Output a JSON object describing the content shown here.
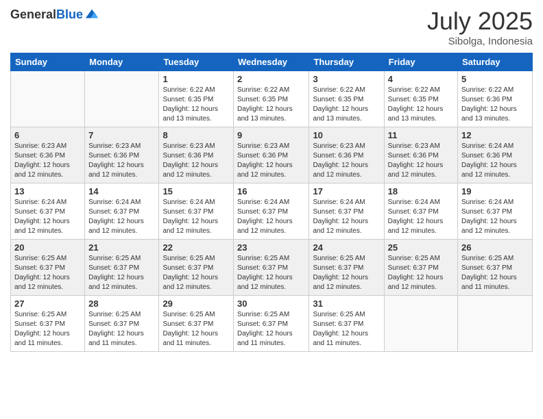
{
  "header": {
    "logo_general": "General",
    "logo_blue": "Blue",
    "month_year": "July 2025",
    "location": "Sibolga, Indonesia"
  },
  "weekdays": [
    "Sunday",
    "Monday",
    "Tuesday",
    "Wednesday",
    "Thursday",
    "Friday",
    "Saturday"
  ],
  "weeks": [
    [
      {
        "day": "",
        "sunrise": "",
        "sunset": "",
        "daylight": ""
      },
      {
        "day": "",
        "sunrise": "",
        "sunset": "",
        "daylight": ""
      },
      {
        "day": "1",
        "sunrise": "Sunrise: 6:22 AM",
        "sunset": "Sunset: 6:35 PM",
        "daylight": "Daylight: 12 hours and 13 minutes."
      },
      {
        "day": "2",
        "sunrise": "Sunrise: 6:22 AM",
        "sunset": "Sunset: 6:35 PM",
        "daylight": "Daylight: 12 hours and 13 minutes."
      },
      {
        "day": "3",
        "sunrise": "Sunrise: 6:22 AM",
        "sunset": "Sunset: 6:35 PM",
        "daylight": "Daylight: 12 hours and 13 minutes."
      },
      {
        "day": "4",
        "sunrise": "Sunrise: 6:22 AM",
        "sunset": "Sunset: 6:35 PM",
        "daylight": "Daylight: 12 hours and 13 minutes."
      },
      {
        "day": "5",
        "sunrise": "Sunrise: 6:22 AM",
        "sunset": "Sunset: 6:36 PM",
        "daylight": "Daylight: 12 hours and 13 minutes."
      }
    ],
    [
      {
        "day": "6",
        "sunrise": "Sunrise: 6:23 AM",
        "sunset": "Sunset: 6:36 PM",
        "daylight": "Daylight: 12 hours and 12 minutes."
      },
      {
        "day": "7",
        "sunrise": "Sunrise: 6:23 AM",
        "sunset": "Sunset: 6:36 PM",
        "daylight": "Daylight: 12 hours and 12 minutes."
      },
      {
        "day": "8",
        "sunrise": "Sunrise: 6:23 AM",
        "sunset": "Sunset: 6:36 PM",
        "daylight": "Daylight: 12 hours and 12 minutes."
      },
      {
        "day": "9",
        "sunrise": "Sunrise: 6:23 AM",
        "sunset": "Sunset: 6:36 PM",
        "daylight": "Daylight: 12 hours and 12 minutes."
      },
      {
        "day": "10",
        "sunrise": "Sunrise: 6:23 AM",
        "sunset": "Sunset: 6:36 PM",
        "daylight": "Daylight: 12 hours and 12 minutes."
      },
      {
        "day": "11",
        "sunrise": "Sunrise: 6:23 AM",
        "sunset": "Sunset: 6:36 PM",
        "daylight": "Daylight: 12 hours and 12 minutes."
      },
      {
        "day": "12",
        "sunrise": "Sunrise: 6:24 AM",
        "sunset": "Sunset: 6:36 PM",
        "daylight": "Daylight: 12 hours and 12 minutes."
      }
    ],
    [
      {
        "day": "13",
        "sunrise": "Sunrise: 6:24 AM",
        "sunset": "Sunset: 6:37 PM",
        "daylight": "Daylight: 12 hours and 12 minutes."
      },
      {
        "day": "14",
        "sunrise": "Sunrise: 6:24 AM",
        "sunset": "Sunset: 6:37 PM",
        "daylight": "Daylight: 12 hours and 12 minutes."
      },
      {
        "day": "15",
        "sunrise": "Sunrise: 6:24 AM",
        "sunset": "Sunset: 6:37 PM",
        "daylight": "Daylight: 12 hours and 12 minutes."
      },
      {
        "day": "16",
        "sunrise": "Sunrise: 6:24 AM",
        "sunset": "Sunset: 6:37 PM",
        "daylight": "Daylight: 12 hours and 12 minutes."
      },
      {
        "day": "17",
        "sunrise": "Sunrise: 6:24 AM",
        "sunset": "Sunset: 6:37 PM",
        "daylight": "Daylight: 12 hours and 12 minutes."
      },
      {
        "day": "18",
        "sunrise": "Sunrise: 6:24 AM",
        "sunset": "Sunset: 6:37 PM",
        "daylight": "Daylight: 12 hours and 12 minutes."
      },
      {
        "day": "19",
        "sunrise": "Sunrise: 6:24 AM",
        "sunset": "Sunset: 6:37 PM",
        "daylight": "Daylight: 12 hours and 12 minutes."
      }
    ],
    [
      {
        "day": "20",
        "sunrise": "Sunrise: 6:25 AM",
        "sunset": "Sunset: 6:37 PM",
        "daylight": "Daylight: 12 hours and 12 minutes."
      },
      {
        "day": "21",
        "sunrise": "Sunrise: 6:25 AM",
        "sunset": "Sunset: 6:37 PM",
        "daylight": "Daylight: 12 hours and 12 minutes."
      },
      {
        "day": "22",
        "sunrise": "Sunrise: 6:25 AM",
        "sunset": "Sunset: 6:37 PM",
        "daylight": "Daylight: 12 hours and 12 minutes."
      },
      {
        "day": "23",
        "sunrise": "Sunrise: 6:25 AM",
        "sunset": "Sunset: 6:37 PM",
        "daylight": "Daylight: 12 hours and 12 minutes."
      },
      {
        "day": "24",
        "sunrise": "Sunrise: 6:25 AM",
        "sunset": "Sunset: 6:37 PM",
        "daylight": "Daylight: 12 hours and 12 minutes."
      },
      {
        "day": "25",
        "sunrise": "Sunrise: 6:25 AM",
        "sunset": "Sunset: 6:37 PM",
        "daylight": "Daylight: 12 hours and 12 minutes."
      },
      {
        "day": "26",
        "sunrise": "Sunrise: 6:25 AM",
        "sunset": "Sunset: 6:37 PM",
        "daylight": "Daylight: 12 hours and 11 minutes."
      }
    ],
    [
      {
        "day": "27",
        "sunrise": "Sunrise: 6:25 AM",
        "sunset": "Sunset: 6:37 PM",
        "daylight": "Daylight: 12 hours and 11 minutes."
      },
      {
        "day": "28",
        "sunrise": "Sunrise: 6:25 AM",
        "sunset": "Sunset: 6:37 PM",
        "daylight": "Daylight: 12 hours and 11 minutes."
      },
      {
        "day": "29",
        "sunrise": "Sunrise: 6:25 AM",
        "sunset": "Sunset: 6:37 PM",
        "daylight": "Daylight: 12 hours and 11 minutes."
      },
      {
        "day": "30",
        "sunrise": "Sunrise: 6:25 AM",
        "sunset": "Sunset: 6:37 PM",
        "daylight": "Daylight: 12 hours and 11 minutes."
      },
      {
        "day": "31",
        "sunrise": "Sunrise: 6:25 AM",
        "sunset": "Sunset: 6:37 PM",
        "daylight": "Daylight: 12 hours and 11 minutes."
      },
      {
        "day": "",
        "sunrise": "",
        "sunset": "",
        "daylight": ""
      },
      {
        "day": "",
        "sunrise": "",
        "sunset": "",
        "daylight": ""
      }
    ]
  ]
}
